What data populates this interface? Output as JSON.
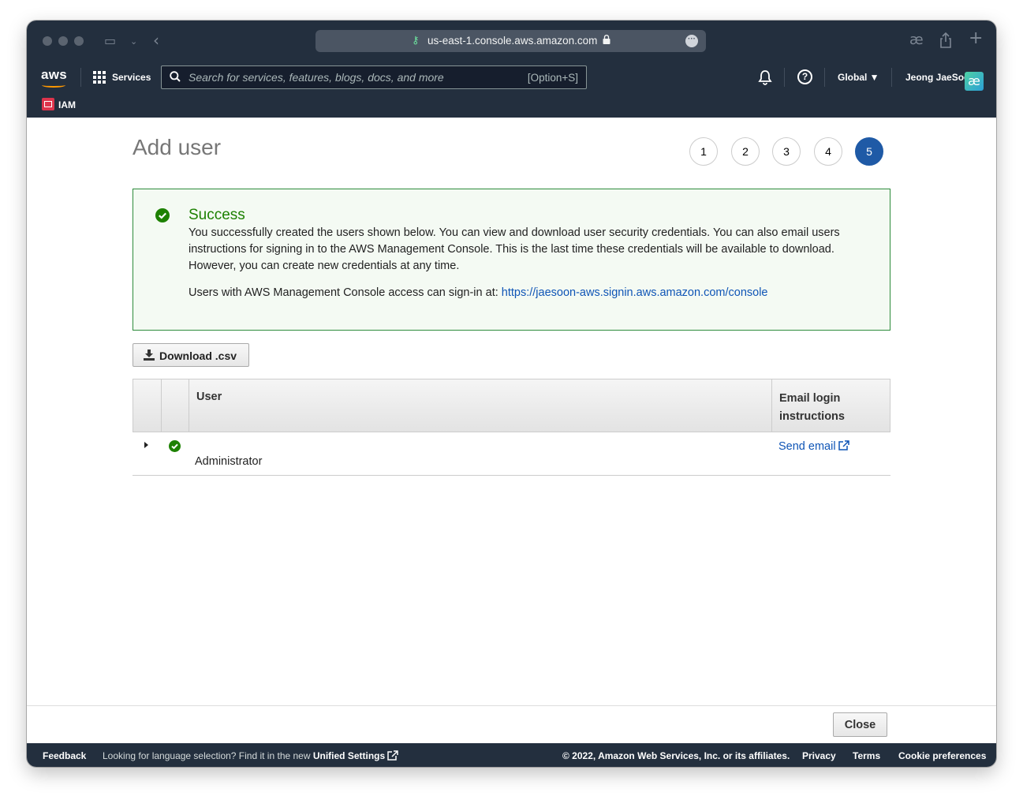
{
  "browser": {
    "url": "us-east-1.console.aws.amazon.com"
  },
  "nav": {
    "logo": "aws",
    "services_label": "Services",
    "search_placeholder": "Search for services, features, blogs, docs, and more",
    "search_shortcut": "[Option+S]",
    "region": "Global ▼",
    "user_name": "Jeong JaeSoon",
    "avatar_glyph": "æ"
  },
  "breadcrumb": {
    "service": "IAM"
  },
  "page": {
    "title": "Add user",
    "steps": [
      "1",
      "2",
      "3",
      "4",
      "5"
    ],
    "active_step": "5"
  },
  "alert": {
    "title": "Success",
    "body": "You successfully created the users shown below. You can view and download user security credentials. You can also email users instructions for signing in to the AWS Management Console. This is the last time these credentials will be available to download. However, you can create new credentials at any time.",
    "signin_prefix": "Users with AWS Management Console access can sign-in at: ",
    "signin_url": "https://jaesoon-aws.signin.aws.amazon.com/console"
  },
  "actions": {
    "download_label": "Download .csv",
    "close_label": "Close"
  },
  "table": {
    "columns": [
      "User",
      "Email login instructions"
    ],
    "rows": [
      {
        "user": "Administrator",
        "email_action": "Send email"
      }
    ]
  },
  "footer": {
    "feedback": "Feedback",
    "language_prefix": "Looking for language selection? Find it in the new ",
    "language_link": "Unified Settings",
    "copyright": "© 2022, Amazon Web Services, Inc. or its affiliates.",
    "privacy": "Privacy",
    "terms": "Terms",
    "cookies": "Cookie preferences"
  },
  "colors": {
    "nav_bg": "#232f3e",
    "success_green": "#1d8102",
    "link_blue": "#0f55b6",
    "active_step": "#1f5aa6"
  }
}
